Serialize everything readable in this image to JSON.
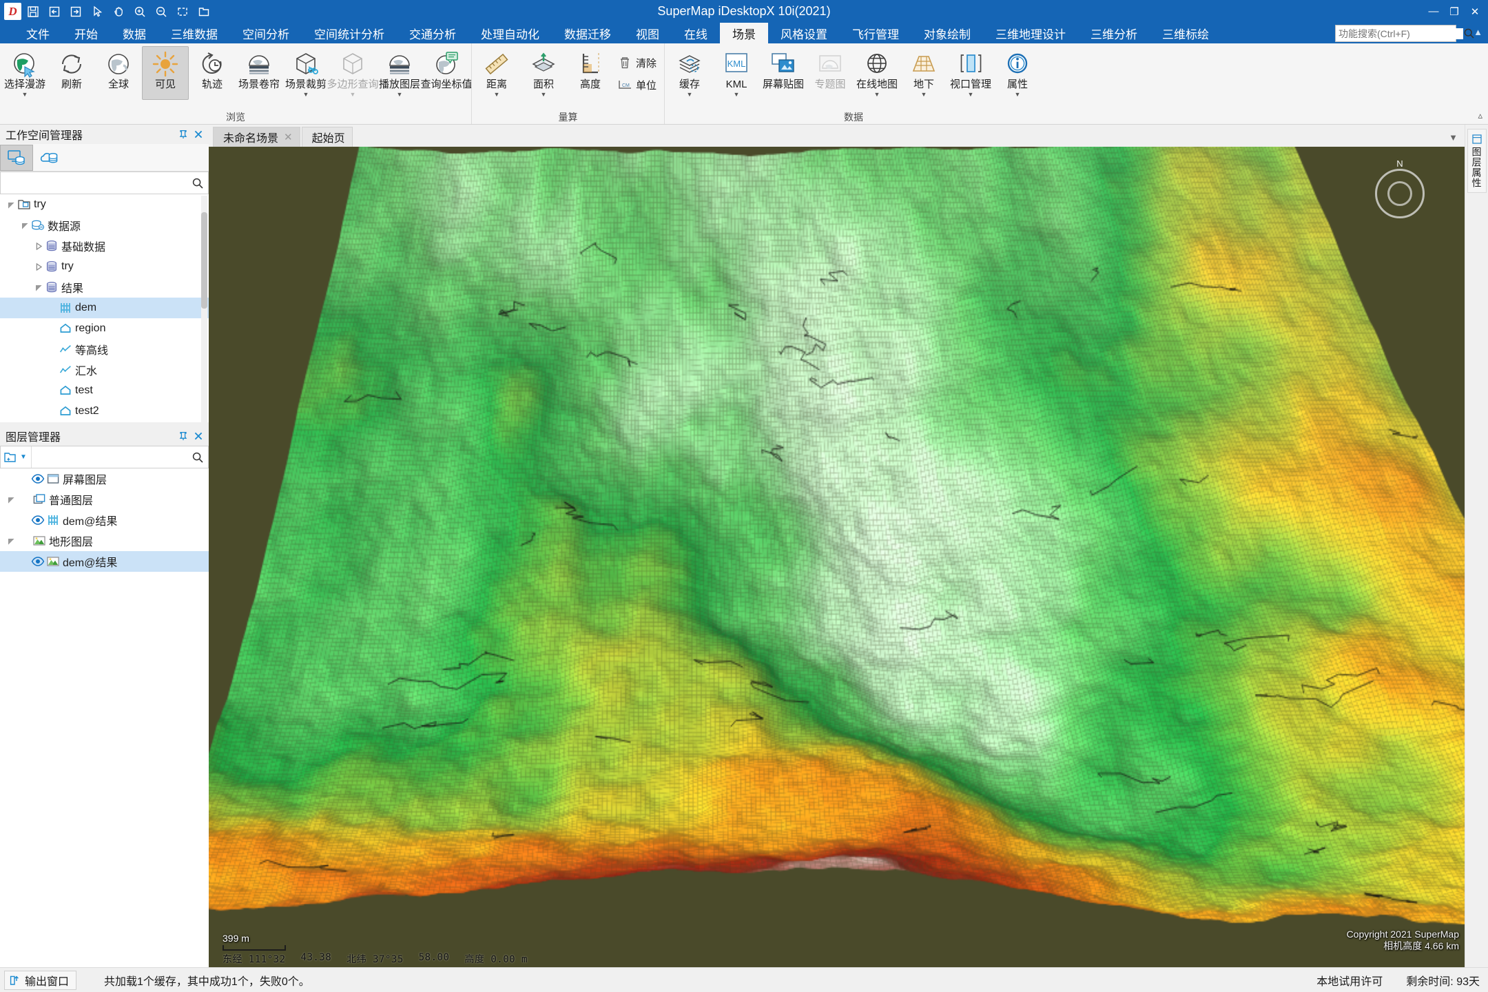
{
  "window": {
    "app_title": "SuperMap iDesktopX 10i(2021)",
    "logo_text": "D",
    "minimize": "—",
    "maximize": "❐",
    "close": "✕"
  },
  "quick_access": [
    {
      "name": "save-icon",
      "label": "保存"
    },
    {
      "name": "undo-icon",
      "label": "撤销"
    },
    {
      "name": "redo-icon",
      "label": "重做"
    },
    {
      "name": "select-icon",
      "label": "选择"
    },
    {
      "name": "pan-icon",
      "label": "平移"
    },
    {
      "name": "zoom-in-icon",
      "label": "放大"
    },
    {
      "name": "zoom-out-icon",
      "label": "缩小"
    },
    {
      "name": "full-extent-icon",
      "label": "全图"
    },
    {
      "name": "open-folder-icon",
      "label": "打开"
    }
  ],
  "ribbon_tabs": [
    {
      "label": "文件",
      "active": false
    },
    {
      "label": "开始",
      "active": false
    },
    {
      "label": "数据",
      "active": false
    },
    {
      "label": "三维数据",
      "active": false
    },
    {
      "label": "空间分析",
      "active": false
    },
    {
      "label": "空间统计分析",
      "active": false
    },
    {
      "label": "交通分析",
      "active": false
    },
    {
      "label": "处理自动化",
      "active": false
    },
    {
      "label": "数据迁移",
      "active": false
    },
    {
      "label": "视图",
      "active": false
    },
    {
      "label": "在线",
      "active": false
    },
    {
      "label": "场景",
      "active": true
    },
    {
      "label": "风格设置",
      "active": false
    },
    {
      "label": "飞行管理",
      "active": false
    },
    {
      "label": "对象绘制",
      "active": false
    },
    {
      "label": "三维地理设计",
      "active": false
    },
    {
      "label": "三维分析",
      "active": false
    },
    {
      "label": "三维标绘",
      "active": false
    }
  ],
  "search": {
    "placeholder": "功能搜索(Ctrl+F)",
    "value": "",
    "icon": "search-icon"
  },
  "ribbon_groups": [
    {
      "title": "浏览",
      "buttons": [
        {
          "label": "选择漫游",
          "icon": "globe-cursor-icon",
          "caret": true,
          "selected": false,
          "disabled": false
        },
        {
          "label": "刷新",
          "icon": "refresh-icon",
          "caret": false,
          "selected": false,
          "disabled": false
        },
        {
          "label": "全球",
          "icon": "globe-icon",
          "caret": false,
          "selected": false,
          "disabled": false
        },
        {
          "label": "可见",
          "icon": "sun-icon",
          "caret": false,
          "selected": true,
          "disabled": false
        },
        {
          "label": "轨迹",
          "icon": "track-clock-icon",
          "caret": false,
          "selected": false,
          "disabled": false
        },
        {
          "label": "场景卷帘",
          "icon": "scene-swipe-icon",
          "caret": false,
          "selected": false,
          "disabled": false
        },
        {
          "label": "场景裁剪",
          "icon": "scene-clip-icon",
          "caret": true,
          "selected": false,
          "disabled": false
        },
        {
          "label": "多边形查询",
          "icon": "polygon-query-icon",
          "caret": true,
          "selected": false,
          "disabled": true
        },
        {
          "label": "播放图层",
          "icon": "play-layer-icon",
          "caret": true,
          "selected": false,
          "disabled": false
        },
        {
          "label": "查询坐标值",
          "icon": "query-coord-icon",
          "caret": false,
          "selected": false,
          "disabled": false
        }
      ]
    },
    {
      "title": "量算",
      "buttons": [
        {
          "label": "距离",
          "icon": "ruler-icon",
          "caret": true,
          "selected": false,
          "disabled": false
        },
        {
          "label": "面积",
          "icon": "area-icon",
          "caret": true,
          "selected": false,
          "disabled": false
        },
        {
          "label": "高度",
          "icon": "height-icon",
          "caret": false,
          "selected": false,
          "disabled": false
        }
      ],
      "small_buttons": [
        {
          "label": "清除",
          "icon": "trash-icon"
        },
        {
          "label": "单位",
          "icon": "unit-icon"
        }
      ]
    },
    {
      "title": "数据",
      "buttons": [
        {
          "label": "缓存",
          "icon": "cache-icon",
          "caret": true,
          "selected": false,
          "disabled": false
        },
        {
          "label": "KML",
          "icon": "kml-icon",
          "caret": true,
          "selected": false,
          "disabled": false
        },
        {
          "label": "屏幕贴图",
          "icon": "screen-overlay-icon",
          "caret": false,
          "selected": false,
          "disabled": false
        },
        {
          "label": "专题图",
          "icon": "thematic-map-icon",
          "caret": false,
          "selected": false,
          "disabled": true
        },
        {
          "label": "在线地图",
          "icon": "online-map-icon",
          "caret": true,
          "selected": false,
          "disabled": false
        },
        {
          "label": "地下",
          "icon": "underground-icon",
          "caret": true,
          "selected": false,
          "disabled": false
        },
        {
          "label": "视口管理",
          "icon": "viewport-manage-icon",
          "caret": true,
          "selected": false,
          "disabled": false
        },
        {
          "label": "属性",
          "icon": "info-icon",
          "caret": true,
          "selected": false,
          "disabled": false
        }
      ]
    }
  ],
  "workspace_panel": {
    "title": "工作空间管理器",
    "pin_icon": "pin-icon",
    "close_icon": "close-icon",
    "tabs": [
      {
        "name": "local-workspace-tab",
        "icon": "local-db-icon",
        "active": true
      },
      {
        "name": "cloud-workspace-tab",
        "icon": "cloud-db-icon",
        "active": false
      }
    ],
    "search": {
      "placeholder": "",
      "value": "",
      "icon": "search-icon"
    },
    "tree": [
      {
        "label": "try",
        "indent": 0,
        "twisty": "open",
        "icon": "workspace-icon",
        "selected": false
      },
      {
        "label": "数据源",
        "indent": 1,
        "twisty": "open",
        "icon": "datasources-icon",
        "selected": false
      },
      {
        "label": "基础数据",
        "indent": 2,
        "twisty": "closed",
        "icon": "datasource-icon",
        "selected": false
      },
      {
        "label": "try",
        "indent": 2,
        "twisty": "closed",
        "icon": "datasource-icon",
        "selected": false
      },
      {
        "label": "结果",
        "indent": 2,
        "twisty": "open",
        "icon": "datasource-icon",
        "selected": false
      },
      {
        "label": "dem",
        "indent": 3,
        "twisty": "none",
        "icon": "grid-dataset-icon",
        "selected": true
      },
      {
        "label": "region",
        "indent": 3,
        "twisty": "none",
        "icon": "region-dataset-icon",
        "selected": false
      },
      {
        "label": "等高线",
        "indent": 3,
        "twisty": "none",
        "icon": "line-dataset-icon",
        "selected": false
      },
      {
        "label": "汇水",
        "indent": 3,
        "twisty": "none",
        "icon": "line-dataset-icon",
        "selected": false
      },
      {
        "label": "test",
        "indent": 3,
        "twisty": "none",
        "icon": "region-dataset-icon",
        "selected": false
      },
      {
        "label": "test2",
        "indent": 3,
        "twisty": "none",
        "icon": "region-dataset-icon",
        "selected": false
      }
    ]
  },
  "layer_panel": {
    "title": "图层管理器",
    "pin_icon": "pin-icon",
    "close_icon": "close-icon",
    "new_group_icon": "new-folder-icon",
    "dropdown_icon": "chevron-down-icon",
    "search": {
      "placeholder": "",
      "value": "",
      "icon": "search-icon"
    },
    "tree": [
      {
        "label": "屏幕图层",
        "indent": 1,
        "twisty": "none",
        "eye": true,
        "icon": "screen-layer-icon",
        "selected": false
      },
      {
        "label": "普通图层",
        "indent": 0,
        "twisty": "open",
        "eye": false,
        "icon": "normal-layer-icon",
        "selected": false
      },
      {
        "label": "dem@结果",
        "indent": 1,
        "twisty": "none",
        "eye": true,
        "icon": "grid-dataset-icon",
        "selected": false
      },
      {
        "label": "地形图层",
        "indent": 0,
        "twisty": "open",
        "eye": false,
        "icon": "terrain-layer-icon",
        "selected": false
      },
      {
        "label": "dem@结果",
        "indent": 1,
        "twisty": "none",
        "eye": true,
        "icon": "terrain-layer-icon",
        "selected": true
      }
    ]
  },
  "doc_tabs": [
    {
      "label": "未命名场景",
      "active": true,
      "closable": true,
      "close_icon": "close-icon"
    },
    {
      "label": "起始页",
      "active": false,
      "closable": false,
      "close_icon": ""
    }
  ],
  "doc_tabs_overflow_icon": "chevron-down-icon",
  "viewport": {
    "compass": {
      "north_label": "N",
      "icon": "compass-icon"
    },
    "scale_bar": {
      "label": "399 m"
    },
    "watermark_line1": "Copyright 2021 SuperMap",
    "watermark_line2": "相机高度 4.66 km",
    "coordinates": [
      "东经 111°32",
      "43.38",
      "北纬 37°35",
      "58.00",
      "高度 0.00 m"
    ]
  },
  "right_strip": [
    {
      "name": "layer-properties-strip",
      "label": "图层属性",
      "icon": "panel-icon"
    }
  ],
  "status_bar": {
    "output_window_label": "输出窗口",
    "output_window_icon": "output-window-icon",
    "message": "共加载1个缓存，其中成功1个，失败0个。",
    "license": "本地试用许可",
    "remaining": "剩余时间: 93天"
  },
  "colors": {
    "title_blue": "#1565b5",
    "accent": "#1b8ad0",
    "selection": "#cbe2f7",
    "ribbon_bg": "#f5f5f5",
    "terrain_low": "#ffffe0",
    "terrain_green": "#17a744",
    "terrain_orange": "#f59b1e",
    "terrain_red": "#a72510",
    "terrain_background": "#4a4a2a"
  }
}
